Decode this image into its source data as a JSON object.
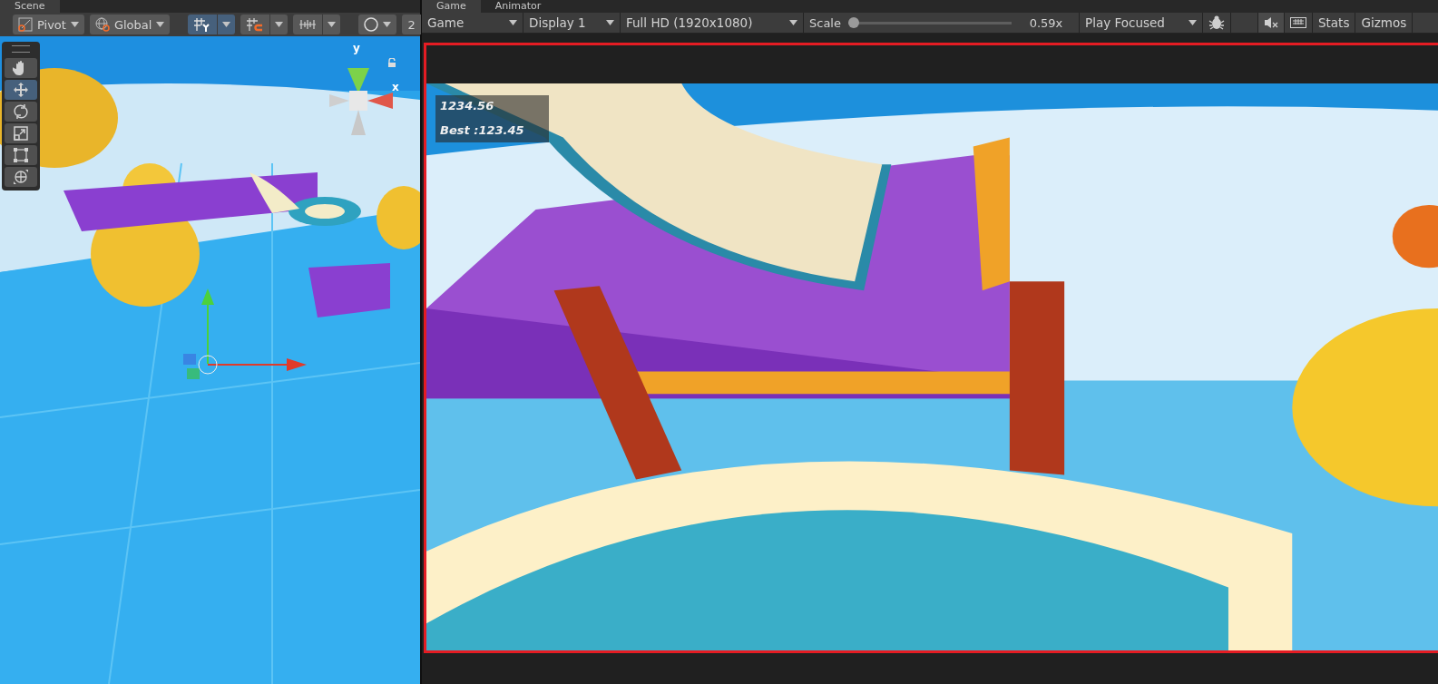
{
  "scene_tabs": [
    {
      "label": "Scene",
      "selected": true
    }
  ],
  "game_tabs": [
    {
      "label": "Game",
      "selected": true
    },
    {
      "label": "Animator",
      "selected": false
    }
  ],
  "scene_toolbar": {
    "pivot": "Pivot",
    "space": "Global",
    "toggles": [
      {
        "kind": "grid",
        "selected": true
      },
      {
        "kind": "snap",
        "selected": false
      },
      {
        "kind": "increment",
        "selected": false
      }
    ],
    "mode_2d": "2"
  },
  "tools": [
    {
      "kind": "hand",
      "selected": false
    },
    {
      "kind": "move",
      "selected": true
    },
    {
      "kind": "rotate",
      "selected": false
    },
    {
      "kind": "scale",
      "selected": false
    },
    {
      "kind": "rect",
      "selected": false
    },
    {
      "kind": "transform",
      "selected": false
    }
  ],
  "scene_gizmo": {
    "y_label": "y",
    "x_label": "x"
  },
  "game_toolbar": {
    "view": "Game",
    "display": "Display 1",
    "resolution": "Full HD (1920x1080)",
    "scale_label": "Scale",
    "scale": {
      "level": 0.0
    },
    "scale_value": "0.59x",
    "play_mode": "Play Focused",
    "mute": {
      "selected": true
    },
    "keyboard": {
      "selected": false
    },
    "stats": "Stats",
    "gizmos": "Gizmos"
  },
  "hud": {
    "score": "1234.56",
    "best": "Best :123.45"
  }
}
